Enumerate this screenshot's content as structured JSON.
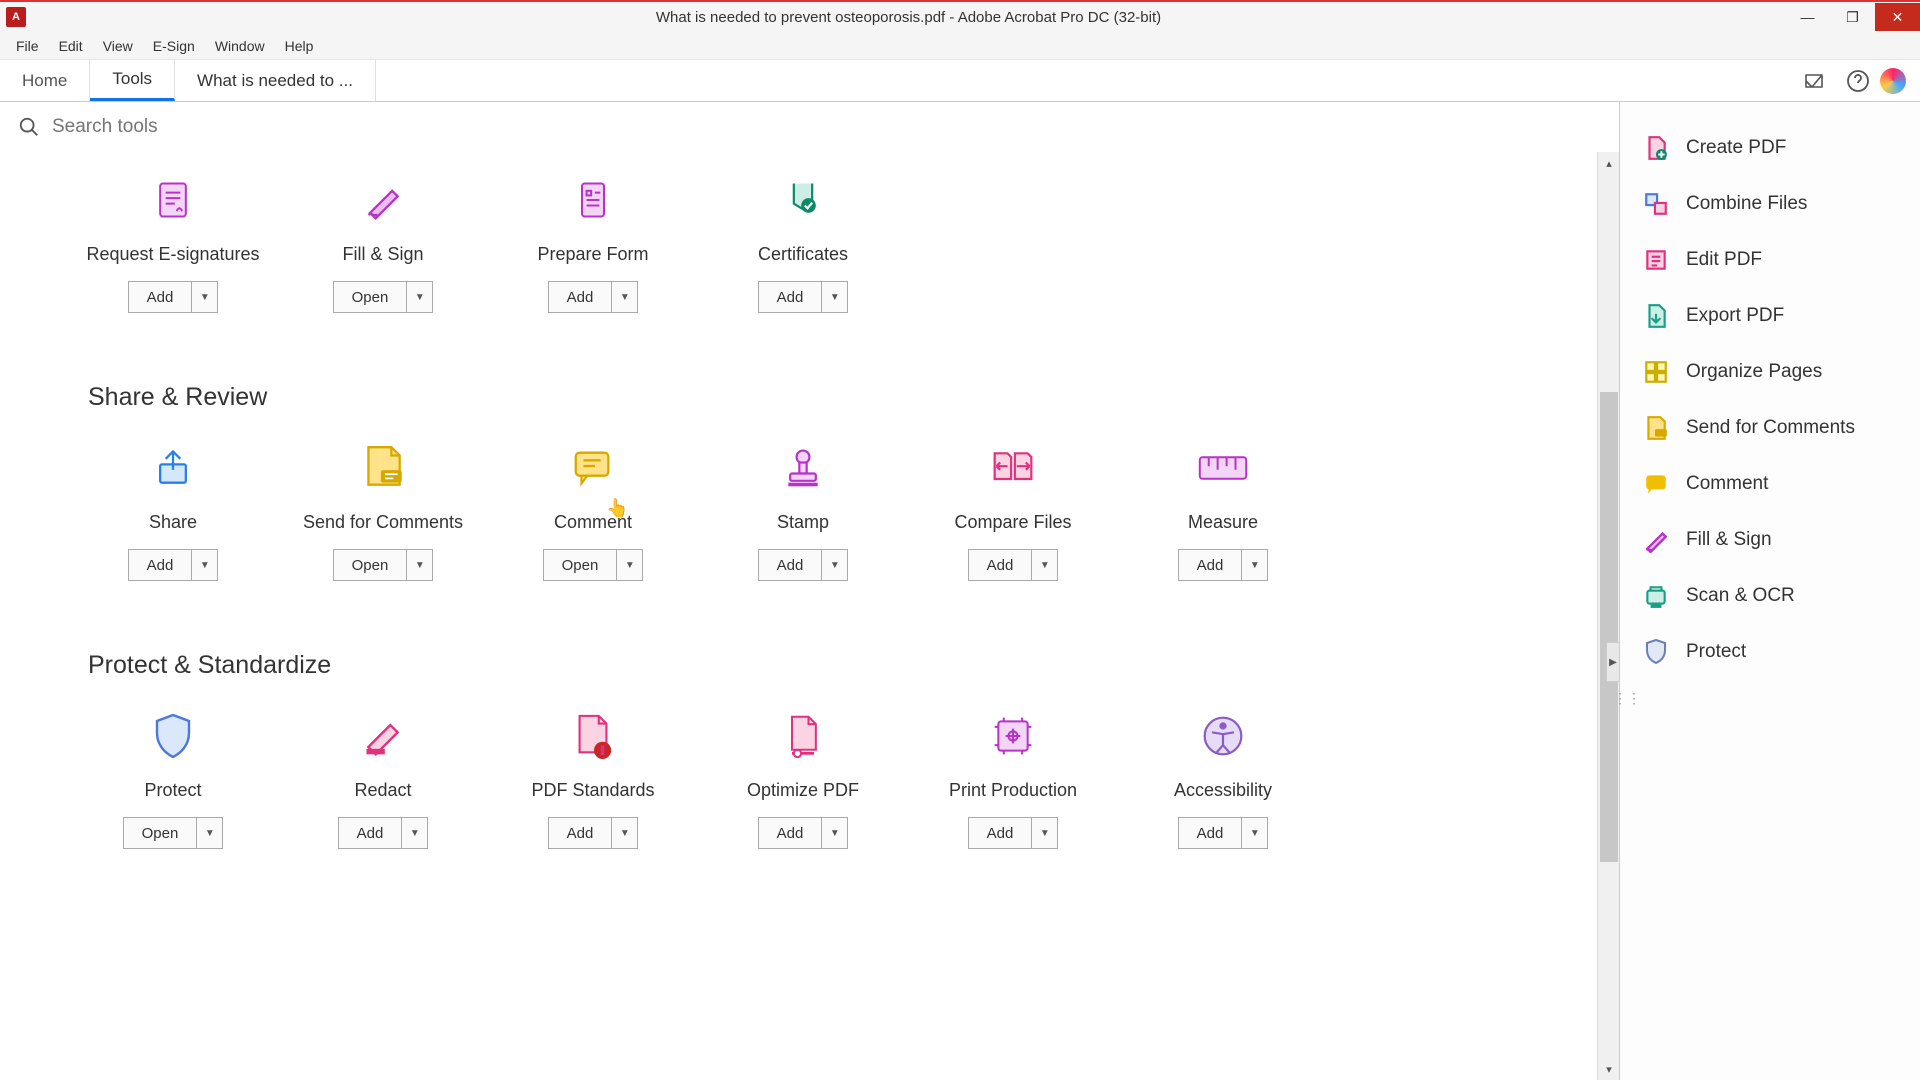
{
  "titlebar": {
    "title": "What is needed to prevent osteoporosis.pdf - Adobe Acrobat Pro DC (32-bit)"
  },
  "menubar": [
    "File",
    "Edit",
    "View",
    "E-Sign",
    "Window",
    "Help"
  ],
  "tabs": {
    "home": "Home",
    "tools": "Tools",
    "doc": "What is needed to ..."
  },
  "search": {
    "placeholder": "Search tools"
  },
  "btn_add": "Add",
  "btn_open": "Open",
  "sections": {
    "s1": {
      "tools": {
        "request_esign": "Request E-signatures",
        "fill_sign": "Fill & Sign",
        "prepare_form": "Prepare Form",
        "certificates": "Certificates"
      }
    },
    "s2": {
      "title": "Share & Review",
      "tools": {
        "share": "Share",
        "send_comments": "Send for Comments",
        "comment": "Comment",
        "stamp": "Stamp",
        "compare": "Compare Files",
        "measure": "Measure"
      }
    },
    "s3": {
      "title": "Protect & Standardize",
      "tools": {
        "protect": "Protect",
        "redact": "Redact",
        "pdf_standards": "PDF Standards",
        "optimize": "Optimize PDF",
        "print_production": "Print Production",
        "accessibility": "Accessibility"
      }
    }
  },
  "rail": {
    "create_pdf": "Create PDF",
    "combine": "Combine Files",
    "edit_pdf": "Edit PDF",
    "export_pdf": "Export PDF",
    "organize": "Organize Pages",
    "send_comments": "Send for Comments",
    "comment": "Comment",
    "fill_sign": "Fill & Sign",
    "scan_ocr": "Scan & OCR",
    "protect": "Protect"
  }
}
